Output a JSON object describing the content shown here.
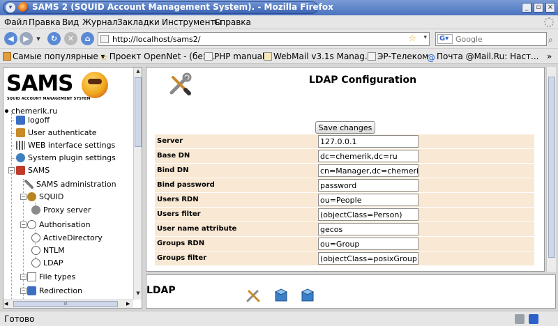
{
  "window": {
    "title": "SAMS 2 (SQUID Account Management System). - Mozilla Firefox",
    "sysmenu_glyph": "▾",
    "minimize_glyph": "_",
    "maximize_glyph": "▫",
    "close_glyph": "×"
  },
  "menu": [
    "Файл",
    "Правка",
    "Вид",
    "Журнал",
    "Закладки",
    "Инструменты",
    "Справка"
  ],
  "nav": {
    "url": "http://localhost/sams2/",
    "search_engine": "G",
    "search_placeholder": "Google",
    "back_glyph": "◀",
    "forward_glyph": "▶",
    "history_glyph": "▾",
    "reload_glyph": "↻",
    "stop_glyph": "✕",
    "home_glyph": "⌂",
    "star_glyph": "☆",
    "url_drop_glyph": "▾",
    "search_glyph": "⌕",
    "search_engine_drop_glyph": "▾"
  },
  "bookmarks": [
    {
      "label": "Самые популярные ▾",
      "icon": "folder-icon"
    },
    {
      "label": "Проект OpenNet - (без...",
      "icon": "star-icon"
    },
    {
      "label": "PHP manual",
      "icon": "page-icon"
    },
    {
      "label": "WebMail v3.1s Manag...",
      "icon": "mail-icon"
    },
    {
      "label": "ЭР-Телеком",
      "icon": "page-icon"
    },
    {
      "label": "Почта @Mail.Ru: Наст...",
      "icon": "at-icon"
    }
  ],
  "bookmarks_overflow": "»",
  "sidebar": {
    "logo": "SAMS",
    "logo_sub": "SQUID ACCOUNT MANAGEMENT SYSTEM",
    "domain": "chemerik.ru",
    "items": [
      {
        "label": "logoff",
        "icon": "lock-icon",
        "color": "#3b6fc4"
      },
      {
        "label": "User authenticate",
        "icon": "user-key-icon",
        "color": "#c98a2a"
      },
      {
        "label": "WEB interface settings",
        "icon": "sliders-icon",
        "color": "#555555"
      },
      {
        "label": "System plugin settings",
        "icon": "gears-icon",
        "color": "#3d7fbf"
      },
      {
        "label": "SAMS",
        "icon": "sams-icon",
        "color": "#c03a2b"
      },
      {
        "label": "SAMS administration",
        "icon": "tools-icon",
        "color": "#777777"
      },
      {
        "label": "SQUID",
        "icon": "squid-icon",
        "color": "#b8841f"
      },
      {
        "label": "Proxy server",
        "icon": "gear-icon",
        "color": "#8a8a8a"
      },
      {
        "label": "Authorisation",
        "icon": "person-key-icon",
        "color": "#666666"
      },
      {
        "label": "ActiveDirectory",
        "icon": "person-key-icon",
        "color": "#666666"
      },
      {
        "label": "NTLM",
        "icon": "person-key-icon",
        "color": "#666666"
      },
      {
        "label": "LDAP",
        "icon": "person-key-icon",
        "color": "#666666"
      },
      {
        "label": "File types",
        "icon": "file-icon",
        "color": "#ffffff"
      },
      {
        "label": "Redirection",
        "icon": "redirect-icon",
        "color": "#3b6fc4"
      }
    ],
    "collapse_glyph": "−",
    "scroll_up_glyph": "▲",
    "scroll_down_glyph": "▼",
    "scroll_left_glyph": "◀",
    "scroll_right_glyph": "▶",
    "hscroll_grip": "III"
  },
  "main": {
    "title": "LDAP Configuration",
    "save_label": "Save changes",
    "fields": [
      {
        "label": "Server",
        "value": "127.0.0.1"
      },
      {
        "label": "Base DN",
        "value": "dc=chemerik,dc=ru"
      },
      {
        "label": "Bind DN",
        "value": "cn=Manager,dc=chemerik,dc=ru"
      },
      {
        "label": "Bind password",
        "value": "password"
      },
      {
        "label": "Users RDN",
        "value": "ou=People"
      },
      {
        "label": "Users filter",
        "value": "(objectClass=Person)"
      },
      {
        "label": "User name attribute",
        "value": "gecos"
      },
      {
        "label": "Groups RDN",
        "value": "ou=Group"
      },
      {
        "label": "Groups filter",
        "value": "(objectClass=posixGroup)"
      }
    ]
  },
  "bottom": {
    "title": "LDAP"
  },
  "status": {
    "text": "Готово"
  }
}
